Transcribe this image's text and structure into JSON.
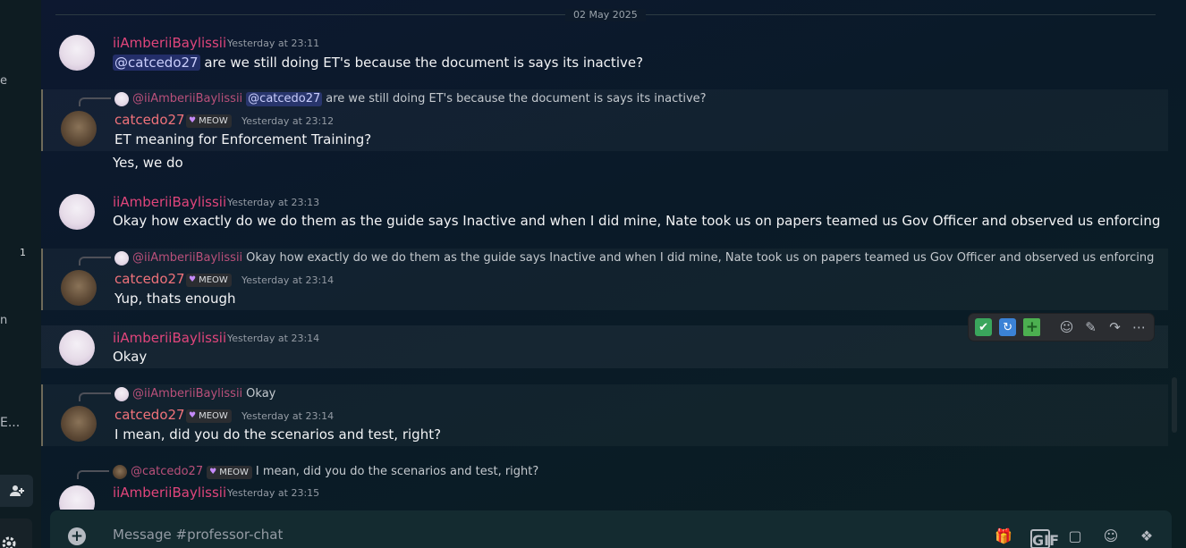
{
  "left_rail": {
    "fragments": [
      "e",
      "1",
      "n",
      "E..."
    ]
  },
  "divider": {
    "date": "02 May 2025"
  },
  "messages": [
    {
      "author": "iiAmberiiBaylissii",
      "timestamp": "Yesterday at 23:11",
      "mention": "@catcedo27",
      "text": " are we still doing ET's because the document is says its inactive?"
    },
    {
      "reply": {
        "name": "@iiAmberiiBaylissii",
        "mention": "@catcedo27",
        "text": " are we still doing ET's because the document is says its inactive?"
      },
      "author": "catcedo27",
      "tag": "MEOW",
      "timestamp": "Yesterday at 23:12",
      "text": "ET meaning for Enforcement Training?"
    },
    {
      "text": "Yes, we do"
    },
    {
      "author": "iiAmberiiBaylissii",
      "timestamp": "Yesterday at 23:13",
      "text": "Okay how exactly do we do them as the guide says Inactive and when I did mine, Nate took us on papers teamed us Gov Officer and observed us enforcing"
    },
    {
      "reply": {
        "name": "@iiAmberiiBaylissii",
        "text": "Okay how exactly do we do them as the guide says Inactive and when I did mine, Nate took us on papers teamed us Gov Officer and observed us enforcing"
      },
      "author": "catcedo27",
      "tag": "MEOW",
      "timestamp": "Yesterday at 23:14",
      "text": "Yup, thats enough"
    },
    {
      "author": "iiAmberiiBaylissii",
      "timestamp": "Yesterday at 23:14",
      "text": "Okay"
    },
    {
      "reply": {
        "name": "@iiAmberiiBaylissii",
        "text": "Okay"
      },
      "author": "catcedo27",
      "tag": "MEOW",
      "timestamp": "Yesterday at 23:14",
      "text": "I mean, did you do the scenarios and test, right?"
    },
    {
      "reply": {
        "name": "@catcedo27",
        "tag": "MEOW",
        "text": "I mean, did you do the scenarios and test, right?"
      },
      "author": "iiAmberiiBaylissii",
      "timestamp": "Yesterday at 23:15",
      "text": ""
    }
  ],
  "action_bar": {
    "icons": [
      "check-emoji-icon",
      "repeat-emoji-icon",
      "plus-emoji-icon",
      "add-reaction-icon",
      "edit-icon",
      "forward-icon",
      "more-icon"
    ]
  },
  "composer": {
    "placeholder": "Message #professor-chat",
    "icons": [
      "gift-icon",
      "gif-icon",
      "sticker-icon",
      "emoji-icon",
      "apps-icon"
    ]
  }
}
